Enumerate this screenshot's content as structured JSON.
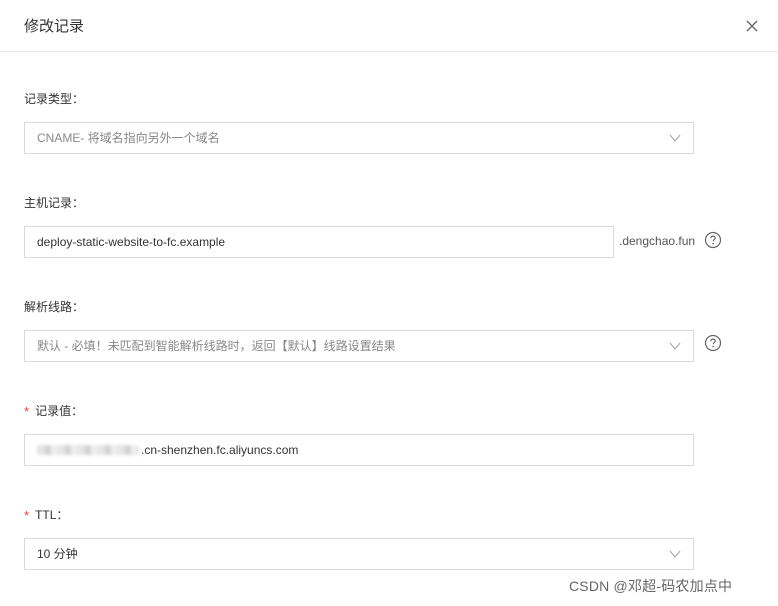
{
  "dialog": {
    "title": "修改记录"
  },
  "fields": {
    "record_type": {
      "label": "记录类型：",
      "value": "CNAME- 将域名指向另外一个域名"
    },
    "host_record": {
      "label": "主机记录：",
      "value": "deploy-static-website-to-fc.example",
      "suffix": ".dengchao.fun"
    },
    "resolution_line": {
      "label": "解析线路：",
      "value": "默认 - 必填！未匹配到智能解析线路时，返回【默认】线路设置结果"
    },
    "record_value": {
      "required_mark": "*",
      "label": "记录值：",
      "value": ".cn-shenzhen.fc.aliyuncs.com"
    },
    "ttl": {
      "required_mark": "*",
      "label": "TTL：",
      "value": "10 分钟"
    }
  },
  "watermark": "CSDN @邓超-码农加点中",
  "icons": {
    "close": "close-icon",
    "dropdown": "chevron-down-icon",
    "help": "help-circle-icon"
  }
}
